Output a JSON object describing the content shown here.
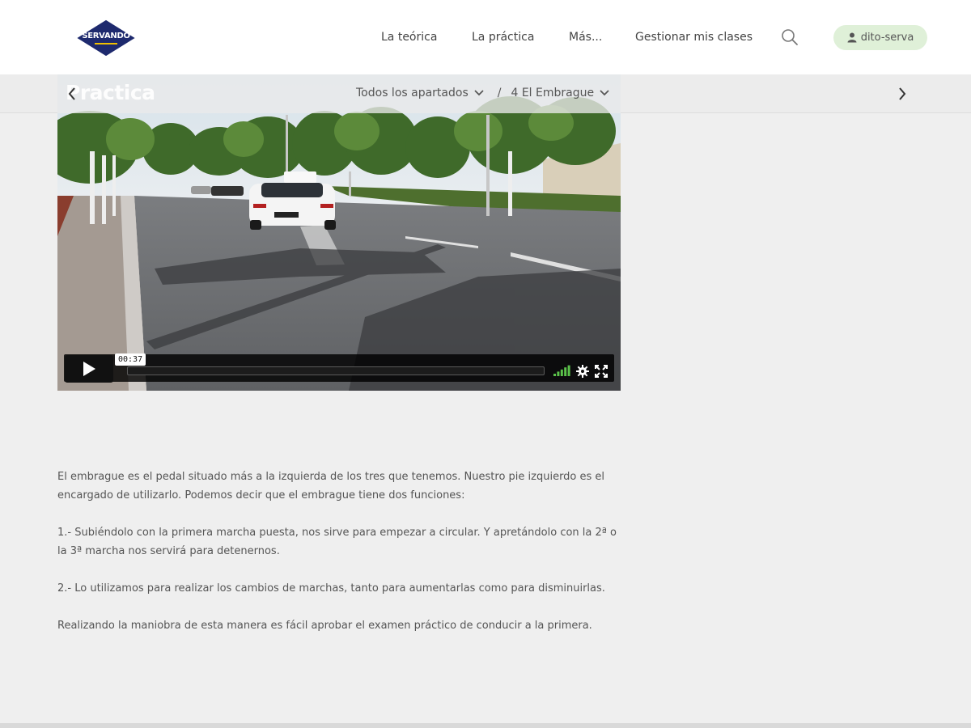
{
  "header": {
    "logo_text": "SERVANDO",
    "nav": [
      "La teórica",
      "La práctica",
      "Más...",
      "Gestionar mis clases"
    ],
    "user": "dito-serva"
  },
  "section_bar": {
    "crumb_all": "Todos los apartados",
    "separator": "/",
    "crumb_current": "4 El Embrague"
  },
  "video": {
    "watermark": "Practica",
    "time": "00:37",
    "progress": 0.0,
    "volume_level": 1.0
  },
  "article": {
    "paragraphs": [
      "El embrague es el pedal situado más a la izquierda de los tres que tenemos. Nuestro pie izquierdo es el encargado de utilizarlo. Podemos decir que el embrague tiene dos funciones:",
      "1.- Subiéndolo con la primera marcha puesta, nos sirve para empezar a circular. Y apretándolo con la 2ª o la 3ª marcha nos servirá para detenernos.",
      "2.- Lo utilizamos para realizar los cambios de marchas, tanto para aumentarlas como para disminuirlas.",
      "Realizando la maniobra de esta manera es fácil aprobar el examen práctico de conducir a la primera."
    ]
  },
  "colors": {
    "logo_navy": "#1e2a6e",
    "user_pill_bg": "#dff0d8",
    "volume_green": "#5bc24a",
    "page_bg": "#efefef"
  },
  "icons": [
    "chevron-left-icon",
    "chevron-right-icon",
    "chevron-down-icon",
    "search-icon",
    "user-icon",
    "play-icon",
    "volume-icon",
    "gear-icon",
    "fullscreen-icon"
  ]
}
